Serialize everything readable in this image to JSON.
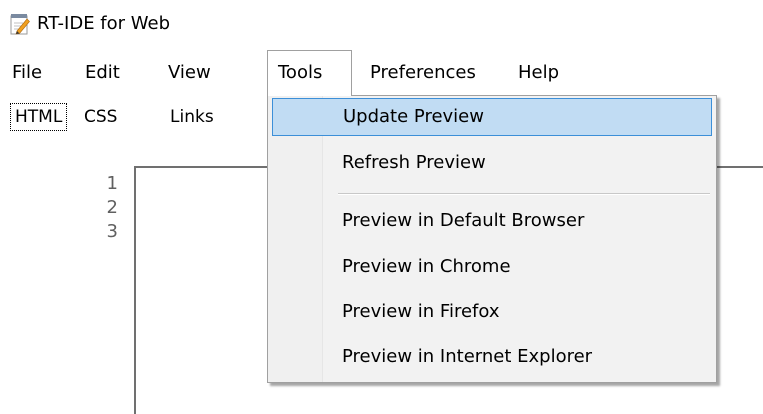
{
  "window": {
    "title": "RT-IDE for Web",
    "icon": "notepad-pencil-icon"
  },
  "menubar": {
    "items": [
      {
        "label": "File"
      },
      {
        "label": "Edit"
      },
      {
        "label": "View"
      },
      {
        "label": "Tools"
      },
      {
        "label": "Preferences"
      },
      {
        "label": "Help"
      }
    ],
    "active": "Tools"
  },
  "tabs": {
    "items": [
      {
        "label": "HTML"
      },
      {
        "label": "CSS"
      },
      {
        "label": "Links"
      }
    ],
    "selected": "HTML"
  },
  "editor": {
    "line_numbers": [
      "1",
      "2",
      "3"
    ]
  },
  "tools_menu": {
    "items": [
      {
        "label": "Update Preview"
      },
      {
        "label": "Refresh Preview"
      },
      {
        "label": "Preview in Default Browser"
      },
      {
        "label": "Preview in Chrome"
      },
      {
        "label": "Preview in Firefox"
      },
      {
        "label": "Preview in Internet Explorer"
      }
    ],
    "highlighted": "Update Preview"
  },
  "colors": {
    "menu_highlight_bg": "#c1dcf3",
    "menu_highlight_border": "#3c8fd8",
    "menu_bg": "#f2f2f2"
  }
}
